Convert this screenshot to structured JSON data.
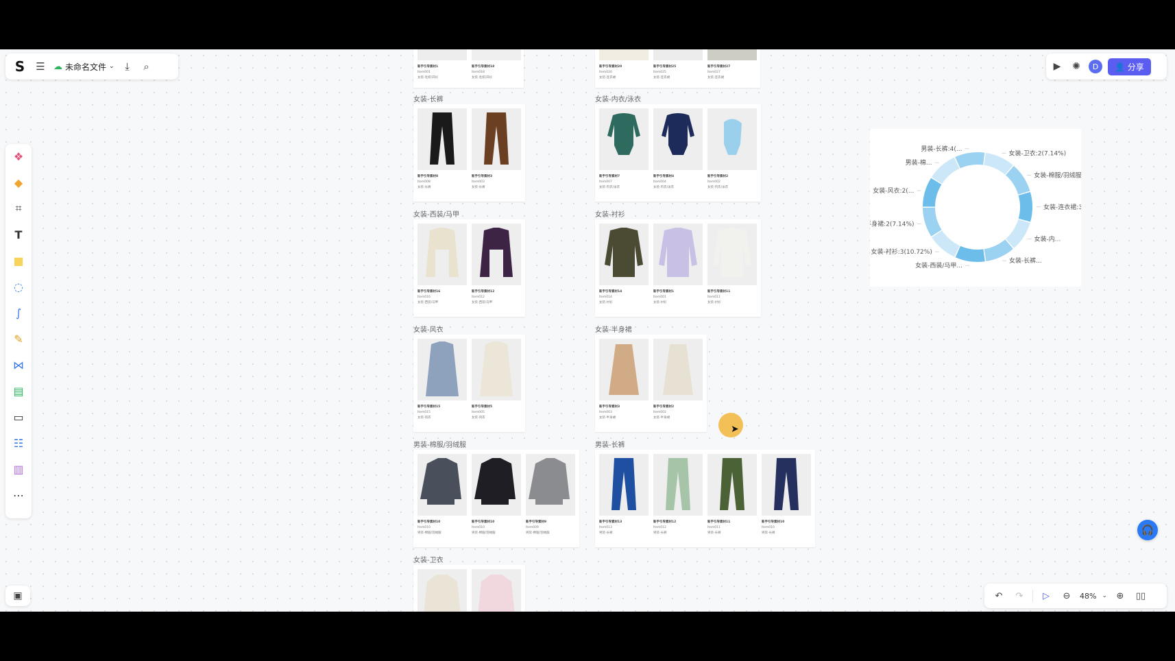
{
  "app": {
    "file_name": "未命名文件",
    "share_label": "分享",
    "avatar_initial": "D",
    "zoom": "48%"
  },
  "colors": {
    "accent": "#5b5df0",
    "help": "#2a7af5",
    "ring_light": "#cce8f8",
    "ring_mid": "#9bd2f1",
    "ring_dark": "#6cbde9"
  },
  "groups": [
    {
      "label": "女装-长裤",
      "items": [
        {
          "name": "新手引导素材8",
          "code": "Item008",
          "cat": "女装-长裤",
          "garment": "trousers",
          "color": "#1a1a1a"
        },
        {
          "name": "新手引导素材3",
          "code": "Item003",
          "cat": "女装-长裤",
          "garment": "trousers",
          "color": "#6b3f22"
        }
      ]
    },
    {
      "label": "女装-内衣/泳衣",
      "items": [
        {
          "name": "新手引导素材7",
          "code": "Item007",
          "cat": "女装-内衣/泳衣",
          "garment": "bodysuit",
          "color": "#2f6a5e"
        },
        {
          "name": "新手引导素材4",
          "code": "Item004",
          "cat": "女装-内衣/泳衣",
          "garment": "bodysuit",
          "color": "#1c2b5a"
        },
        {
          "name": "新手引导素材2",
          "code": "Item002",
          "cat": "女装-内衣/泳衣",
          "garment": "swimsuit",
          "color": "#9ad0ec"
        }
      ]
    },
    {
      "label": "女装-西装/马甲",
      "items": [
        {
          "name": "新手引导素材16",
          "code": "Item016",
          "cat": "女装-西装/马甲",
          "garment": "jacket",
          "color": "#e9e2cf"
        },
        {
          "name": "新手引导素材12",
          "code": "Item012",
          "cat": "女装-西装/马甲",
          "garment": "jacket",
          "color": "#3d2344"
        }
      ]
    },
    {
      "label": "女装-衬衫",
      "items": [
        {
          "name": "新手引导素材14",
          "code": "Item014",
          "cat": "女装-衬衫",
          "garment": "shirt",
          "color": "#4b4a33"
        },
        {
          "name": "新手引导素材1",
          "code": "Item001",
          "cat": "女装-衬衫",
          "garment": "shirt",
          "color": "#c9c0e6"
        },
        {
          "name": "新手引导素材11",
          "code": "Item011",
          "cat": "女装-衬衫",
          "garment": "shirt",
          "color": "#f1f1ee"
        }
      ]
    },
    {
      "label": "女装-风衣",
      "items": [
        {
          "name": "新手引导素材15",
          "code": "Item015",
          "cat": "女装-风衣",
          "garment": "coat",
          "color": "#8fa2bd"
        },
        {
          "name": "新手引导素材5",
          "code": "Item005",
          "cat": "女装-风衣",
          "garment": "coat",
          "color": "#ece6d9"
        }
      ]
    },
    {
      "label": "女装-半身裙",
      "items": [
        {
          "name": "新手引导素材3",
          "code": "Item003",
          "cat": "女装-半身裙",
          "garment": "skirt",
          "color": "#d1ab85"
        },
        {
          "name": "新手引导素材2",
          "code": "Item002",
          "cat": "女装-半身裙",
          "garment": "skirt",
          "color": "#e6e1d2"
        }
      ]
    },
    {
      "label": "男装-棉服/羽绒服",
      "items": [
        {
          "name": "新手引导素材10",
          "code": "Item010",
          "cat": "男装-棉服/羽绒服",
          "garment": "puffer",
          "color": "#4a4f5c"
        },
        {
          "name": "新手引导素材10",
          "code": "Item010",
          "cat": "男装-棉服/羽绒服",
          "garment": "puffer",
          "color": "#1e1e24"
        },
        {
          "name": "新手引导素材9",
          "code": "Item009",
          "cat": "男装-棉服/羽绒服",
          "garment": "puffer",
          "color": "#8a8c90"
        }
      ]
    },
    {
      "label": "男装-长裤",
      "items": [
        {
          "name": "新手引导素材13",
          "code": "Item013",
          "cat": "男装-长裤",
          "garment": "trousers",
          "color": "#1f4fa0"
        },
        {
          "name": "新手引导素材12",
          "code": "Item012",
          "cat": "男装-长裤",
          "garment": "trousers",
          "color": "#a6c4a8"
        },
        {
          "name": "新手引导素材11",
          "code": "Item011",
          "cat": "男装-长裤",
          "garment": "trousers",
          "color": "#4b6136"
        },
        {
          "name": "新手引导素材10",
          "code": "Item010",
          "cat": "男装-长裤",
          "garment": "trousers",
          "color": "#26305e"
        }
      ]
    },
    {
      "label": "女装-卫衣",
      "items": [
        {
          "name": "",
          "code": "",
          "cat": "",
          "garment": "hoodie",
          "color": "#e9e4d6"
        },
        {
          "name": "",
          "code": "",
          "cat": "",
          "garment": "hoodie",
          "color": "#f1d8de"
        }
      ]
    }
  ],
  "top_partial": {
    "left": [
      {
        "name": "新手引导素材1",
        "code": "Item001",
        "cat": "女装-毛织/开衫",
        "color": "#c8c8c8"
      },
      {
        "name": "新手引导素材18",
        "code": "Item018",
        "cat": "女装-毛织/开衫",
        "color": "#cfcfcf"
      }
    ],
    "right": [
      {
        "name": "新手引导素材20",
        "code": "Item020",
        "cat": "女装-连衣裙",
        "color": "#d9c9a8"
      },
      {
        "name": "新手引导素材25",
        "code": "Item025",
        "cat": "女装-连衣裙",
        "color": "#c6c6c6"
      },
      {
        "name": "新手引导素材27",
        "code": "Item027",
        "cat": "女装-连衣裙",
        "color": "#6a6a50"
      }
    ]
  },
  "chart_data": {
    "type": "pie",
    "donut": true,
    "slices": [
      {
        "label": "女装-卫衣:2(7.14%)"
      },
      {
        "label": "女装-棉服/羽绒服:2(7.1..."
      },
      {
        "label": "女装-连衣裙:3(..."
      },
      {
        "label": "女装-内..."
      },
      {
        "label": "女装-长裤..."
      },
      {
        "label": "女装-西装/马甲..."
      },
      {
        "label": "女装-衬衫:3(10.72%)"
      },
      {
        "label": "女装-半身裙:2(7.14%)"
      },
      {
        "label": "女装-风衣:2(..."
      },
      {
        "label": "男装-棉..."
      },
      {
        "label": "男装-长裤:4(..."
      }
    ]
  }
}
